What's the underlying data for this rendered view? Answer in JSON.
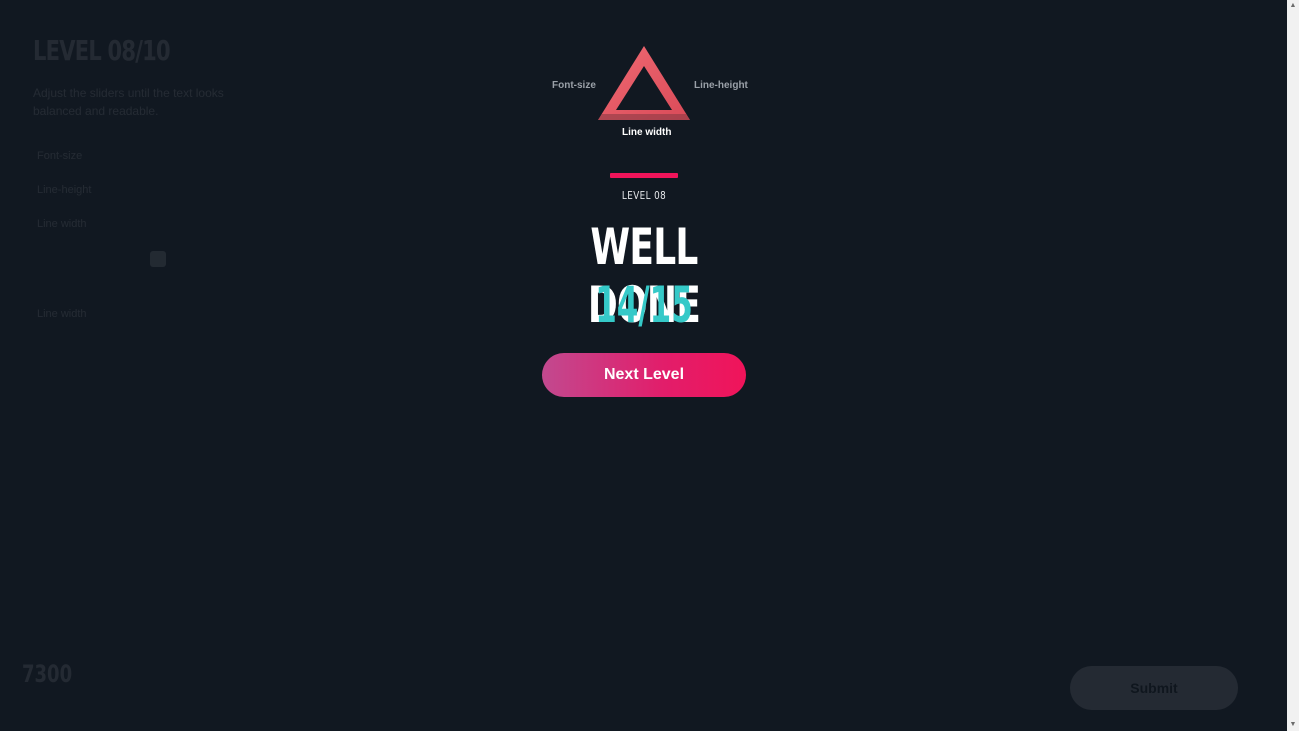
{
  "background": {
    "title": "LEVEL 08/10",
    "description": "Adjust the sliders until the text looks balanced and readable.",
    "controls": [
      "Font-size",
      "Line-height",
      "Line width"
    ],
    "slider_label": "Line width",
    "counter": "7300",
    "submit_label": "Submit"
  },
  "diagram": {
    "label_left": "Font-size",
    "label_right": "Line-height",
    "label_bottom": "Line width",
    "color": "#e85b66"
  },
  "result": {
    "level": "LEVEL 08",
    "headline": "WELL DONE",
    "score": "14/15",
    "accent_color": "#f0145a",
    "score_color": "#35c9c8"
  },
  "actions": {
    "next_label": "Next Level"
  }
}
